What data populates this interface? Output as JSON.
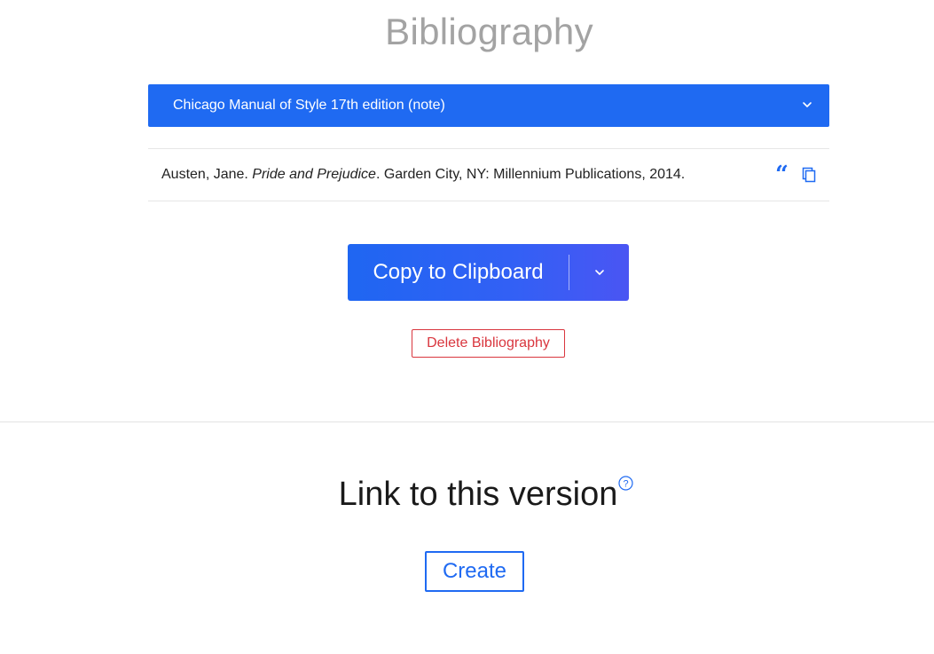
{
  "header": {
    "title": "Bibliography"
  },
  "style_selector": {
    "selected": "Chicago Manual of Style 17th edition (note)"
  },
  "entries": [
    {
      "author": "Austen, Jane.",
      "title": "Pride and Prejudice",
      "rest": ". Garden City, NY: Millennium Publications, 2014."
    }
  ],
  "actions": {
    "copy_label": "Copy to Clipboard",
    "delete_label": "Delete Bibliography"
  },
  "link_section": {
    "title": "Link to this version",
    "help_glyph": "?",
    "create_label": "Create"
  },
  "icons": {
    "quote": "quote-icon",
    "copy": "copy-icon",
    "chevron": "chevron-down-icon",
    "help": "help-circle-icon"
  },
  "colors": {
    "accent": "#1f6af2",
    "danger": "#d9363e",
    "title_gray": "#a3a3a3"
  }
}
